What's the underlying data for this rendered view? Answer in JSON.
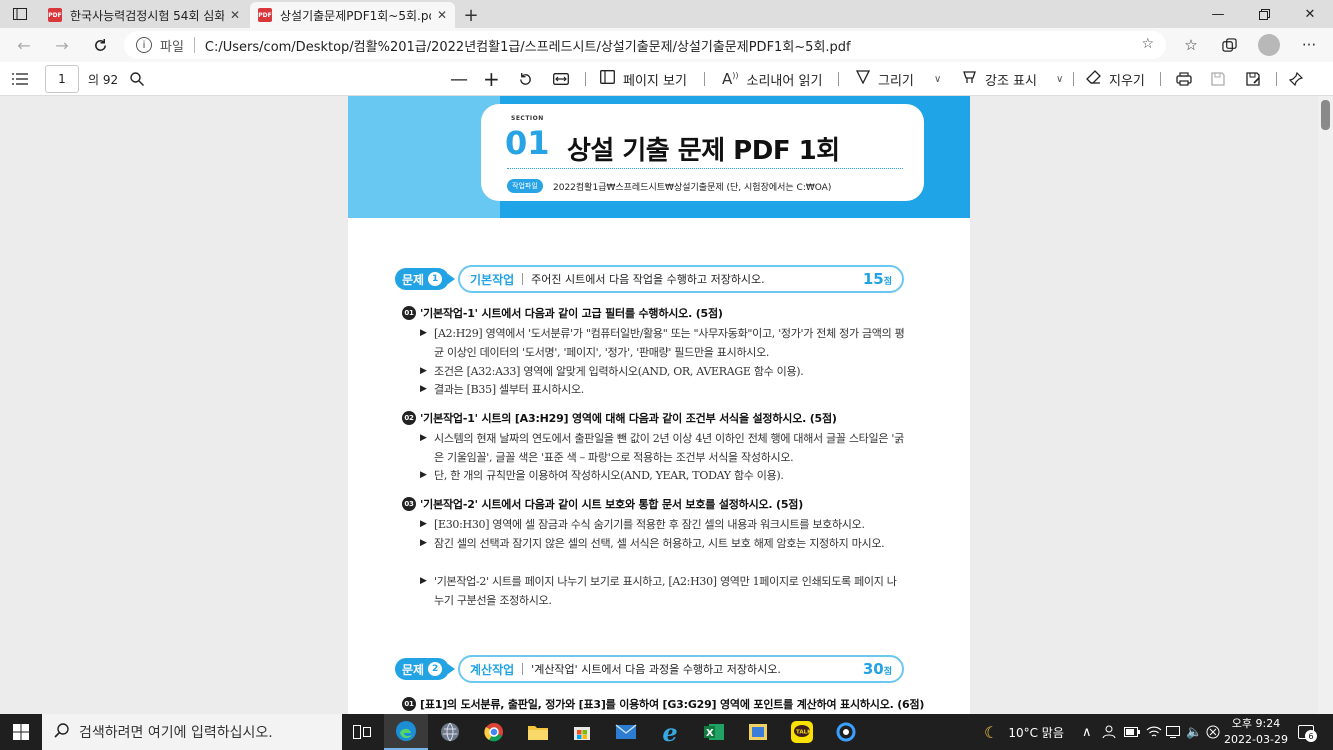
{
  "browser": {
    "tabs": [
      {
        "title": "한국사능력검정시험 54회 심화 ©",
        "icon": "pdf-icon",
        "active": false
      },
      {
        "title": "상설기출문제PDF1회~5회.pdf",
        "icon": "pdf-icon",
        "active": true
      }
    ],
    "address": {
      "scheme": "파일",
      "url": "C:/Users/com/Desktop/컴활%201급/2022년컴활1급/스프레드시트/상설기출문제/상설기출문제PDF1회~5회.pdf"
    }
  },
  "pdf_toolbar": {
    "current_page": "1",
    "total_pages": "의 92",
    "page_view": "페이지 보기",
    "read_aloud": "소리내어 읽기",
    "draw": "그리기",
    "highlight": "강조 표시",
    "erase": "지우기"
  },
  "document": {
    "section_label": "SECTION",
    "section_number": "01",
    "title": "상설 기출 문제 PDF 1회",
    "file_badge": "작업파일",
    "file_path": "2022컴활1급₩스프레드시트₩상설기출문제 (단, 시험장에서는 C:₩OA)",
    "problems": [
      {
        "badge": "문제",
        "number": "1",
        "category": "기본작업",
        "description": "주어진 시트에서 다음 작업을 수행하고 저장하시오.",
        "score": "15",
        "score_unit": "점",
        "tasks": [
          {
            "num": "01",
            "title": "'기본작업-1' 시트에서 다음과 같이 고급 필터를 수행하시오. (5점)",
            "bullets": [
              "[A2:H29] 영역에서 '도서분류'가 \"컴퓨터일반/활용\" 또는 \"사무자동화\"이고, '정가'가 전체 정가 금액의 평균 이상인 데이터의 '도서명', '페이지', '정가', '판매량' 필드만을 표시하시오.",
              "조건은 [A32:A33] 영역에 알맞게 입력하시오(AND, OR, AVERAGE 함수 이용).",
              "결과는 [B35] 셀부터 표시하시오."
            ]
          },
          {
            "num": "02",
            "title": "'기본작업-1' 시트의 [A3:H29] 영역에 대해 다음과 같이 조건부 서식을 설정하시오. (5점)",
            "bullets": [
              "시스템의 현재 날짜의 연도에서 출판일을 뺀 값이 2년 이상 4년 이하인 전체 행에 대해서 글꼴 스타일은 '굵은 기울임꼴', 글꼴 색은 '표준 색 – 파랑'으로 적용하는 조건부 서식을 작성하시오.",
              "단, 한 개의 규칙만을 이용하여 작성하시오(AND, YEAR, TODAY 함수 이용)."
            ]
          },
          {
            "num": "03",
            "title": "'기본작업-2' 시트에서 다음과 같이 시트 보호와 통합 문서 보호를 설정하시오. (5점)",
            "bullets": [
              "[E30:H30] 영역에 셀 잠금과 수식 숨기기를 적용한 후 잠긴 셀의 내용과 워크시트를 보호하시오.",
              "잠긴 셀의 선택과 잠기지 않은 셀의 선택, 셀 서식은 허용하고, 시트 보호 해제 암호는 지정하지 마시오.",
              "'기본작업-2' 시트를 페이지 나누기 보기로 표시하고, [A2:H30] 영역만 1페이지로 인쇄되도록 페이지 나누기 구분선을 조정하시오."
            ]
          }
        ]
      },
      {
        "badge": "문제",
        "number": "2",
        "category": "계산작업",
        "description": "'계산작업' 시트에서 다음 과정을 수행하고 저장하시오.",
        "score": "30",
        "score_unit": "점",
        "tasks": [
          {
            "num": "01",
            "title": "[표1]의 도서분류, 출판일, 정가와 [표3]를 이용하여 [G3:G29] 영역에 포인트를 계산하여 표시하시오. (6점)",
            "bullets": []
          }
        ]
      }
    ]
  },
  "taskbar": {
    "search_placeholder": "검색하려면 여기에 입력하십시오.",
    "weather": "10°C 맑음",
    "time": "오후 9:24",
    "date": "2022-03-29",
    "notifications": "6"
  },
  "colors": {
    "accent": "#22a3e4",
    "header_light": "#68c8f2",
    "pdf_red": "#d9373b",
    "taskbar": "#1f1f1f"
  }
}
